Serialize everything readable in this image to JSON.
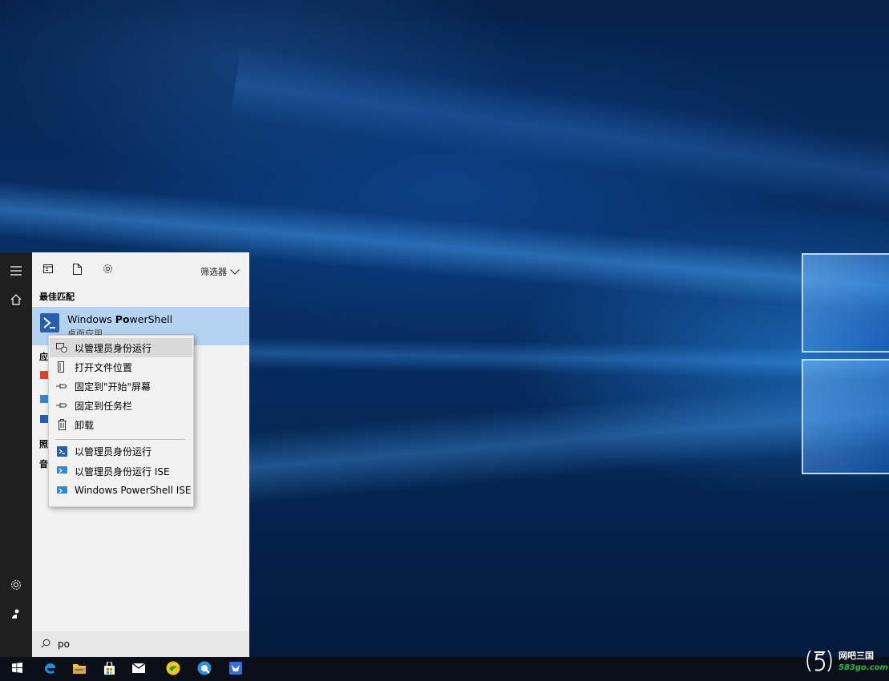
{
  "panel": {
    "filter_label": "筛选器",
    "best_match_title": "最佳匹配",
    "best_match": {
      "title_prefix": "Windows ",
      "title_bold": "Po",
      "title_suffix": "werShell",
      "subtitle": "桌面应用"
    },
    "apps_section_label": "应",
    "settings_label": "照",
    "music_label": "音",
    "search_query": "po"
  },
  "context_menu": {
    "items": [
      {
        "label": "以管理员身份运行",
        "icon": "run-as-admin-icon"
      },
      {
        "label": "打开文件位置",
        "icon": "open-folder-icon"
      },
      {
        "label": "固定到\"开始\"屏幕",
        "icon": "pin-start-icon"
      },
      {
        "label": "固定到任务栏",
        "icon": "pin-taskbar-icon"
      },
      {
        "label": "卸载",
        "icon": "uninstall-icon"
      },
      {
        "label": "以管理员身份运行",
        "icon": "powershell-icon"
      },
      {
        "label": "以管理员身份运行 ISE",
        "icon": "powershell-ise-icon"
      },
      {
        "label": "Windows PowerShell ISE",
        "icon": "powershell-ise-icon"
      }
    ]
  },
  "watermark": {
    "top": "网吧三国",
    "bottom": "583go.com"
  },
  "colors": {
    "powershell_blue": "#2a5ea8",
    "highlight": "#b3d3f0",
    "taskbar": "#0b0f17"
  }
}
